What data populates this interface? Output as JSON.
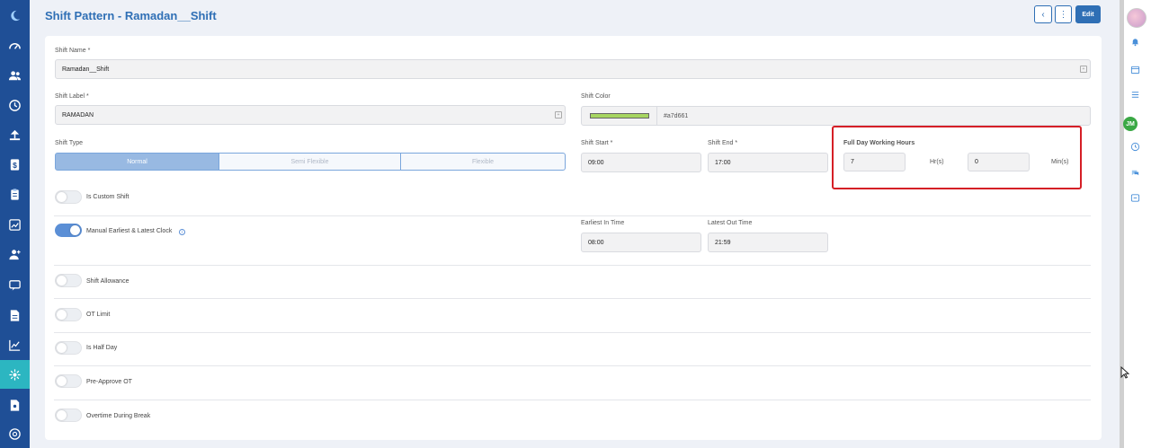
{
  "header": {
    "title": "Shift Pattern - Ramadan__Shift",
    "edit_label": "Edit",
    "back_icon": "chevron-left-icon",
    "more_icon": "more-vertical-icon"
  },
  "form": {
    "shift_name": {
      "label": "Shift Name *",
      "value": "Ramadan__Shift"
    },
    "shift_label": {
      "label": "Shift Label *",
      "value": "RAMADAN"
    },
    "shift_color": {
      "label": "Shift Color",
      "value": "#a7d661",
      "swatch": "#a7d661"
    },
    "shift_type": {
      "label": "Shift Type",
      "options": [
        "Normal",
        "Semi Flexible",
        "Flexible"
      ],
      "selected": "Normal"
    },
    "shift_start": {
      "label": "Shift Start *",
      "value": "09:00"
    },
    "shift_end": {
      "label": "Shift End *",
      "value": "17:00"
    },
    "full_day": {
      "label": "Full Day Working Hours",
      "hours": "7",
      "hours_unit": "Hr(s)",
      "mins": "0",
      "mins_unit": "Min(s)"
    },
    "earliest_in": {
      "label": "Earliest In Time",
      "value": "08:00"
    },
    "latest_out": {
      "label": "Latest Out Time",
      "value": "21:59"
    }
  },
  "toggles": {
    "custom_shift": {
      "label": "Is Custom Shift",
      "on": false
    },
    "manual_clock": {
      "label": "Manual Earliest & Latest Clock",
      "on": true
    },
    "allowance": {
      "label": "Shift Allowance",
      "on": false
    },
    "ot_limit": {
      "label": "OT Limit",
      "on": false
    },
    "half_day": {
      "label": "Is Half Day",
      "on": false
    },
    "pre_approve": {
      "label": "Pre-Approve OT",
      "on": false
    },
    "overtime_break": {
      "label": "Overtime During Break",
      "on": false
    }
  },
  "right_rail": {
    "user_initials": "JM"
  },
  "colors": {
    "primary": "#2f6fb5",
    "nav_bg": "#1f4f96",
    "nav_active": "#2cb6c1",
    "highlight": "#d51f26",
    "toggle_on": "#5b8fd6"
  }
}
